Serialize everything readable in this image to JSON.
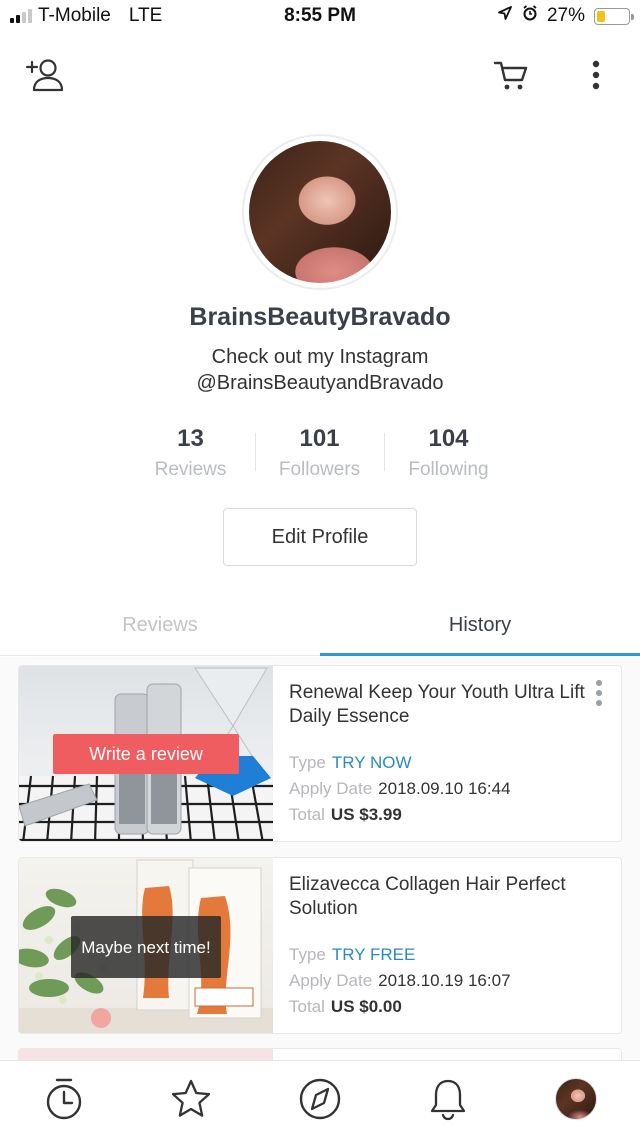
{
  "status_bar": {
    "carrier": "T-Mobile",
    "network": "LTE",
    "time": "8:55 PM",
    "battery_text": "27%",
    "battery_level": 0.27,
    "battery_color": "#f3c21a"
  },
  "top_nav": {
    "icons": [
      "add-person-icon",
      "cart-icon",
      "more-vertical-icon"
    ]
  },
  "profile": {
    "username": "BrainsBeautyBravado",
    "bio_line1": "Check out my Instagram",
    "bio_line2": "@BrainsBeautyandBravado",
    "stats": [
      {
        "value": "13",
        "label": "Reviews"
      },
      {
        "value": "101",
        "label": "Followers"
      },
      {
        "value": "104",
        "label": "Following"
      }
    ],
    "edit_button": "Edit Profile"
  },
  "tabs": [
    {
      "label": "Reviews",
      "active": false
    },
    {
      "label": "History",
      "active": true
    }
  ],
  "accent_color": "#2d96d3",
  "history": [
    {
      "title": "Renewal Keep Your Youth Ultra Lift Daily Essence",
      "overlay": "Write a review",
      "type_label": "Type",
      "type_value": "TRY NOW",
      "date_label": "Apply Date",
      "date_value": "2018.09.10 16:44",
      "total_label": "Total",
      "total_value": "US $3.99"
    },
    {
      "title": "Elizavecca Collagen Hair Perfect Solution",
      "overlay": "Maybe next time!",
      "type_label": "Type",
      "type_value": "TRY FREE",
      "date_label": "Apply Date",
      "date_value": "2018.10.19 16:07",
      "total_label": "Total",
      "total_value": "US $0.00"
    }
  ],
  "bottom_nav": {
    "icons": [
      "timer-icon",
      "star-icon",
      "compass-icon",
      "bell-icon",
      "profile-avatar"
    ]
  }
}
